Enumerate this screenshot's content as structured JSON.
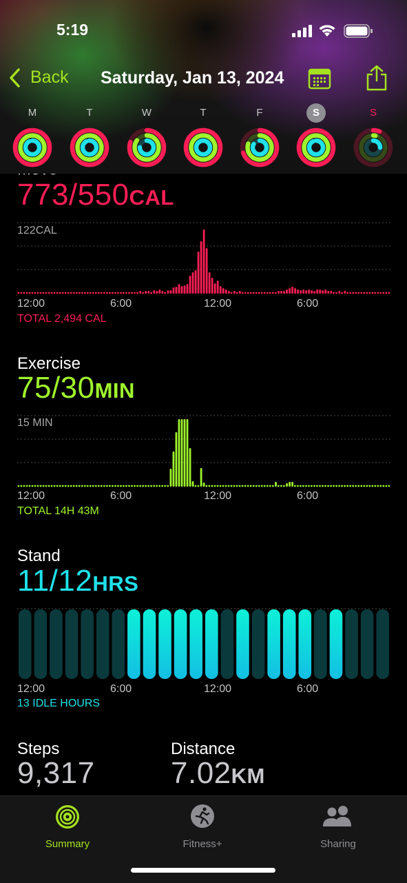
{
  "status_bar": {
    "time": "5:19"
  },
  "nav": {
    "back_label": "Back",
    "date_title": "Saturday, Jan 13, 2024"
  },
  "colors": {
    "move": "#fa1e55",
    "exercise": "#9ff42c",
    "stand": "#1fe1ea",
    "accent": "#a5e21f"
  },
  "week": {
    "days": [
      {
        "letter": "M",
        "move": 1.4,
        "exercise": 2.5,
        "stand": 0.92
      },
      {
        "letter": "T",
        "move": 1.35,
        "exercise": 2.0,
        "stand": 0.92
      },
      {
        "letter": "W",
        "move": 0.8,
        "exercise": 0.85,
        "stand": 0.75
      },
      {
        "letter": "T",
        "move": 1.3,
        "exercise": 2.2,
        "stand": 1.0
      },
      {
        "letter": "F",
        "move": 0.7,
        "exercise": 0.8,
        "stand": 0.83
      },
      {
        "letter": "S",
        "move": 1.4,
        "exercise": 2.5,
        "stand": 0.92,
        "selected": true
      },
      {
        "letter": "S",
        "move": 0.06,
        "exercise": 0.03,
        "stand": 0.25,
        "today": true
      }
    ]
  },
  "move": {
    "title": "Move",
    "value": "773/550",
    "unit": "CAL",
    "max_label": "122CAL",
    "total": "TOTAL 2,494 CAL",
    "axis": [
      "12:00",
      "6:00",
      "12:00",
      "6:00"
    ]
  },
  "exercise": {
    "title": "Exercise",
    "value": "75/30",
    "unit": "MIN",
    "max_label": "15 MIN",
    "total": "TOTAL 14H 43M",
    "axis": [
      "12:00",
      "6:00",
      "12:00",
      "6:00"
    ]
  },
  "stand": {
    "title": "Stand",
    "value": "11/12",
    "unit": "HRS",
    "total": "13 IDLE HOURS",
    "axis": [
      "12:00",
      "6:00",
      "12:00",
      "6:00"
    ],
    "hours": [
      0,
      0,
      0,
      0,
      0,
      0,
      0,
      1,
      1,
      1,
      1,
      1,
      1,
      0,
      1,
      0,
      1,
      1,
      1,
      0,
      1,
      0,
      0,
      0
    ]
  },
  "stats": {
    "steps_label": "Steps",
    "steps_value": "9,317",
    "distance_label": "Distance",
    "distance_value": "7.02",
    "distance_unit": "KM"
  },
  "tabs": [
    {
      "label": "Summary",
      "icon": "activity-rings-icon",
      "active": true
    },
    {
      "label": "Fitness+",
      "icon": "running-figure-icon",
      "active": false
    },
    {
      "label": "Sharing",
      "icon": "people-icon",
      "active": false
    }
  ]
}
